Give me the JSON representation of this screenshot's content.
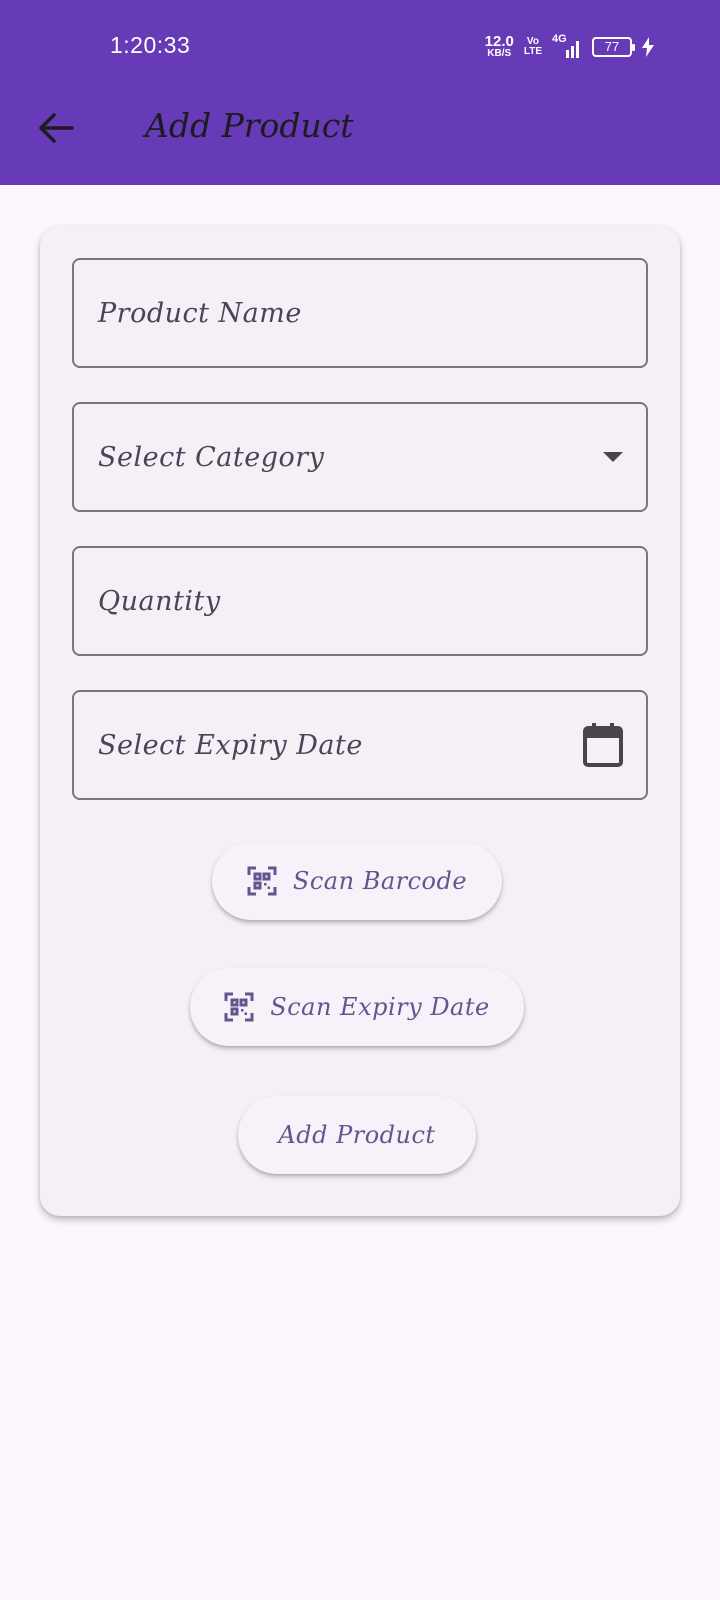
{
  "status_bar": {
    "time": "1:20:33",
    "net_speed_value": "12.0",
    "net_speed_unit": "KB/S",
    "volte_top": "Vo",
    "volte_bottom": "LTE",
    "network_type": "4G",
    "battery_level": "77"
  },
  "app_bar": {
    "title": "Add Product",
    "background_color": "#673ab7",
    "back_icon": "arrow-back-icon"
  },
  "form": {
    "product_name_placeholder": "Product Name",
    "category_placeholder": "Select Category",
    "quantity_placeholder": "Quantity",
    "expiry_date_placeholder": "Select Expiry Date",
    "dropdown_icon": "dropdown-arrow-icon",
    "calendar_icon": "calendar-icon"
  },
  "buttons": {
    "scan_barcode": "Scan Barcode",
    "scan_expiry_date": "Scan Expiry Date",
    "add_product": "Add Product",
    "scan_icon": "qr-scan-icon",
    "accent_color": "#65558f"
  }
}
